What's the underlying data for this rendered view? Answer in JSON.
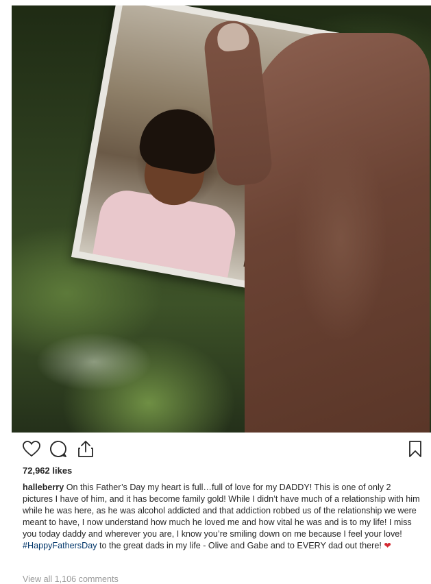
{
  "post": {
    "likes_text": "72,962 likes",
    "caption": {
      "username": "halleberry",
      "text_before_hashtag": "On this Father’s Day my heart is full…full of love for my DADDY! This is one of only 2 pictures I have of him, and it has become family gold! While I didn’t have much of a relationship with him while he was here, as he was alcohol addicted and that addiction robbed us of the relationship we were meant to have, I now understand how much he loved me and how vital he was and is to my life! I miss you today daddy and wherever you are, I know you’re smiling down on me because I feel your love!",
      "hashtag": "#HappyFathersDay",
      "text_after_hashtag": "to the great dads in my life - Olive and Gabe and to EVERY dad out there!",
      "emoji": "❤"
    },
    "view_comments": "View all 1,106 comments"
  },
  "icons": {
    "like": "heart-icon",
    "comment": "comment-icon",
    "share": "share-icon",
    "save": "bookmark-icon"
  },
  "colors": {
    "hashtag": "#003569",
    "heart_emoji": "#d42a32",
    "muted": "#999999"
  }
}
